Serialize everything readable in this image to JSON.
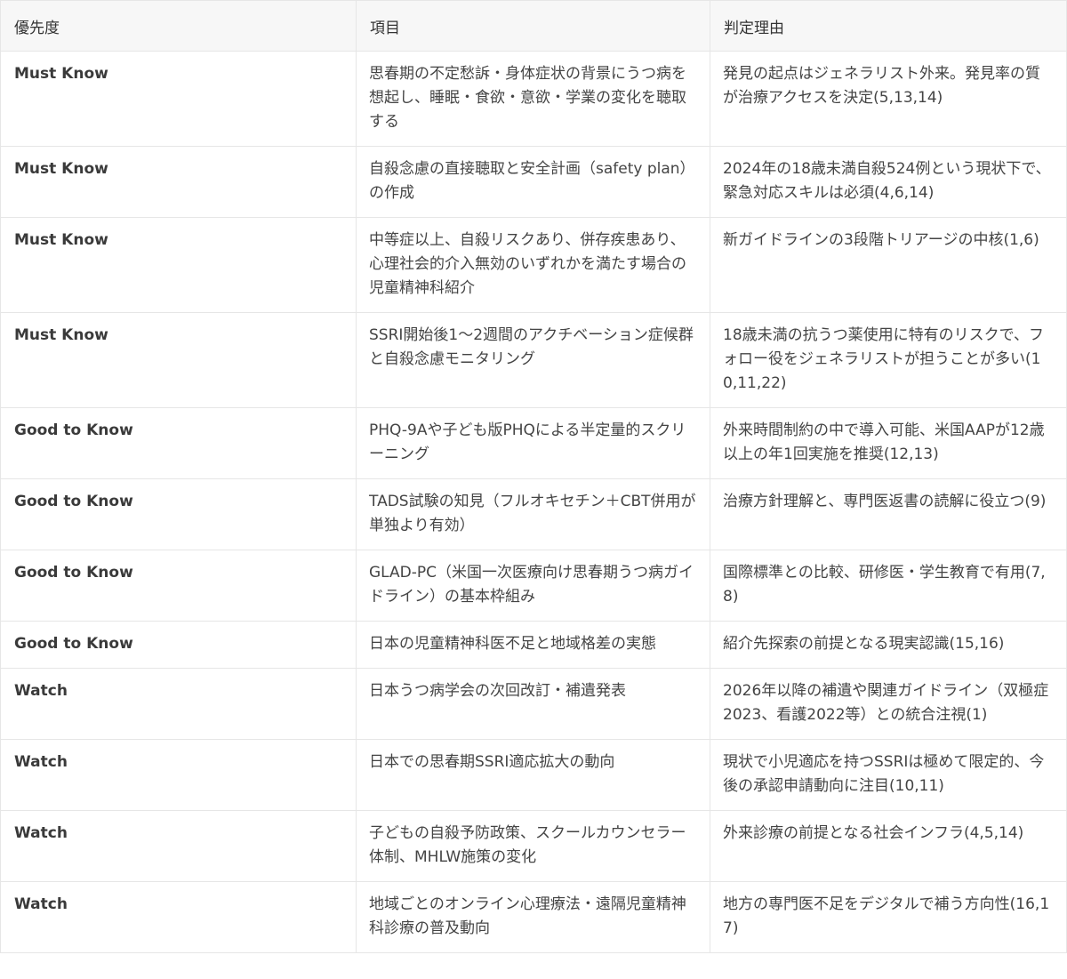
{
  "table": {
    "headers": [
      "優先度",
      "項目",
      "判定理由"
    ],
    "rows": [
      {
        "priority": "Must Know",
        "item": "思春期の不定愁訴・身体症状の背景にうつ病を想起し、睡眠・食欲・意欲・学業の変化を聴取する",
        "reason": "発見の起点はジェネラリスト外来。発見率の質が治療アクセスを決定(5,13,14)"
      },
      {
        "priority": "Must Know",
        "item": "自殺念慮の直接聴取と安全計画（safety plan）の作成",
        "reason": "2024年の18歳未満自殺524例という現状下で、緊急対応スキルは必須(4,6,14)"
      },
      {
        "priority": "Must Know",
        "item": "中等症以上、自殺リスクあり、併存疾患あり、心理社会的介入無効のいずれかを満たす場合の児童精神科紹介",
        "reason": "新ガイドラインの3段階トリアージの中核(1,6)"
      },
      {
        "priority": "Must Know",
        "item": "SSRI開始後1〜2週間のアクチベーション症候群と自殺念慮モニタリング",
        "reason": "18歳未満の抗うつ薬使用に特有のリスクで、フォロー役をジェネラリストが担うことが多い(10,11,22)"
      },
      {
        "priority": "Good to Know",
        "item": "PHQ-9Aや子ども版PHQによる半定量的スクリーニング",
        "reason": "外来時間制約の中で導入可能、米国AAPが12歳以上の年1回実施を推奨(12,13)"
      },
      {
        "priority": "Good to Know",
        "item": "TADS試験の知見（フルオキセチン＋CBT併用が単独より有効）",
        "reason": "治療方針理解と、専門医返書の読解に役立つ(9)"
      },
      {
        "priority": "Good to Know",
        "item": "GLAD-PC（米国一次医療向け思春期うつ病ガイドライン）の基本枠組み",
        "reason": "国際標準との比較、研修医・学生教育で有用(7,8)"
      },
      {
        "priority": "Good to Know",
        "item": "日本の児童精神科医不足と地域格差の実態",
        "reason": "紹介先探索の前提となる現実認識(15,16)"
      },
      {
        "priority": "Watch",
        "item": "日本うつ病学会の次回改訂・補遺発表",
        "reason": "2026年以降の補遺や関連ガイドライン（双極症2023、看護2022等）との統合注視(1)"
      },
      {
        "priority": "Watch",
        "item": "日本での思春期SSRI適応拡大の動向",
        "reason": "現状で小児適応を持つSSRIは極めて限定的、今後の承認申請動向に注目(10,11)"
      },
      {
        "priority": "Watch",
        "item": "子どもの自殺予防政策、スクールカウンセラー体制、MHLW施策の変化",
        "reason": "外来診療の前提となる社会インフラ(4,5,14)"
      },
      {
        "priority": "Watch",
        "item": "地域ごとのオンライン心理療法・遠隔児童精神科診療の普及動向",
        "reason": "地方の専門医不足をデジタルで補う方向性(16,17)"
      }
    ]
  }
}
